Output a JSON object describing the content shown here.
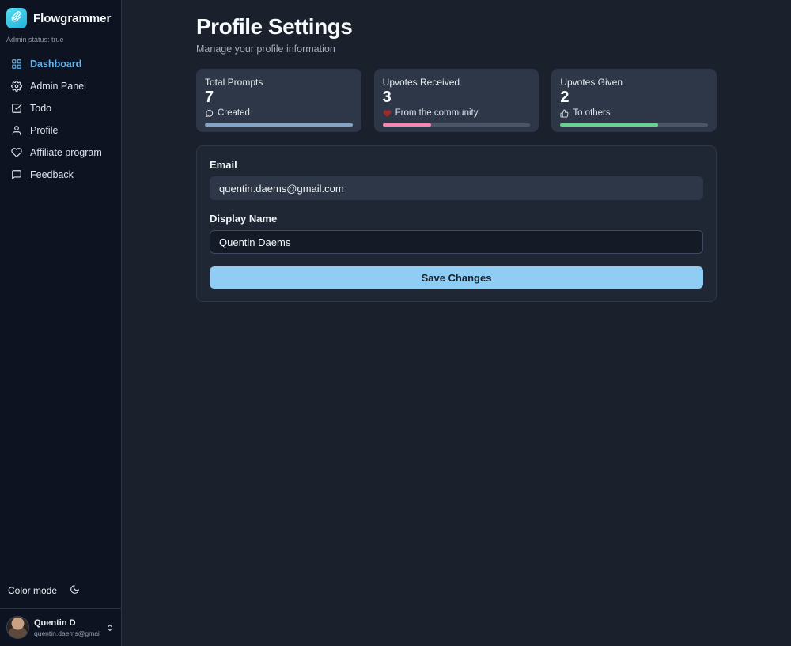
{
  "app": {
    "name": "Flowgrammer",
    "admin_status": "Admin status: true",
    "logo_icon": "paperclip-icon",
    "logo_color": "#2fc0e4"
  },
  "sidebar": {
    "items": [
      {
        "label": "Dashboard",
        "icon": "dashboard-grid-icon",
        "active": true
      },
      {
        "label": "Admin Panel",
        "icon": "gear-icon",
        "active": false
      },
      {
        "label": "Todo",
        "icon": "todo-check-icon",
        "active": false
      },
      {
        "label": "Profile",
        "icon": "person-icon",
        "active": false
      },
      {
        "label": "Affiliate program",
        "icon": "heart-hand-icon",
        "active": false
      },
      {
        "label": "Feedback",
        "icon": "speech-bubble-icon",
        "active": false
      }
    ],
    "active_color": "#63b3ed",
    "color_mode_label": "Color mode",
    "color_mode_icon": "moon-icon",
    "user": {
      "name": "Quentin D",
      "email": "quentin.daems@gmail.c...",
      "chevron_icon": "up-down-chevrons-icon"
    }
  },
  "page": {
    "title": "Profile Settings",
    "subtitle": "Manage your profile information"
  },
  "stats": [
    {
      "label": "Total Prompts",
      "value": "7",
      "caption": "Created",
      "icon": "speech-bubble-icon",
      "progress": 100,
      "bar_color": "#86a5c6"
    },
    {
      "label": "Upvotes Received",
      "value": "3",
      "caption": "From the community",
      "icon": "heart-icon",
      "progress": 33,
      "bar_color": "#f687b3"
    },
    {
      "label": "Upvotes Given",
      "value": "2",
      "caption": "To others",
      "icon": "thumbs-up-icon",
      "progress": 66,
      "bar_color": "#68d391"
    }
  ],
  "form": {
    "email_label": "Email",
    "email_value": "quentin.daems@gmail.com",
    "display_name_label": "Display Name",
    "display_name_value": "Quentin Daems",
    "save_label": "Save Changes",
    "save_color": "#90cdf4"
  }
}
